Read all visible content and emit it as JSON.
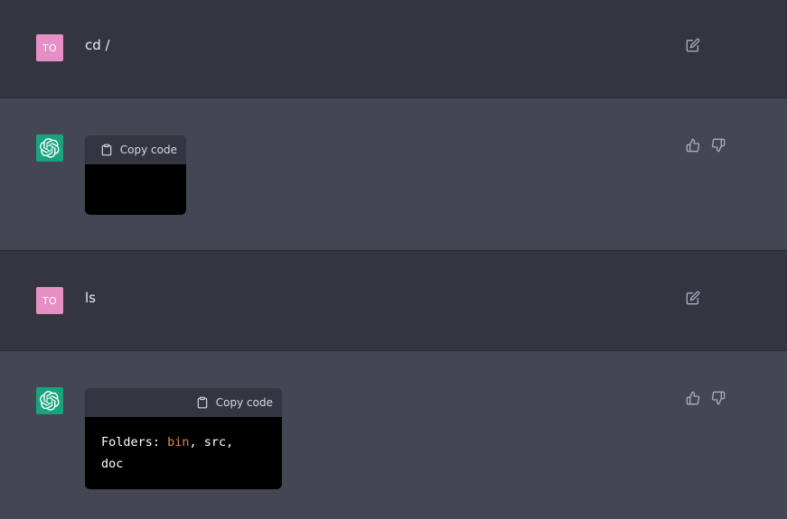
{
  "turns": [
    {
      "role": "user",
      "avatar_initials": "TO",
      "text": "cd /"
    },
    {
      "role": "assistant",
      "copy_label": "Copy code",
      "code": ""
    },
    {
      "role": "user",
      "avatar_initials": "TO",
      "text": "ls"
    },
    {
      "role": "assistant",
      "copy_label": "Copy code",
      "code_tokens": [
        "Folders: ",
        "bin",
        ", src,",
        "doc"
      ]
    }
  ],
  "colors": {
    "user_bg": "#343541",
    "assistant_bg": "#444654",
    "user_avatar": "#e58fc5",
    "bot_avatar": "#19a37f",
    "code_bg": "#000000",
    "code_highlight": "#df8a4a"
  },
  "icons": {
    "edit": "edit-icon",
    "thumbs_up": "thumbs-up-icon",
    "thumbs_down": "thumbs-down-icon",
    "clipboard": "clipboard-icon",
    "bot_logo": "openai-logo-icon"
  }
}
